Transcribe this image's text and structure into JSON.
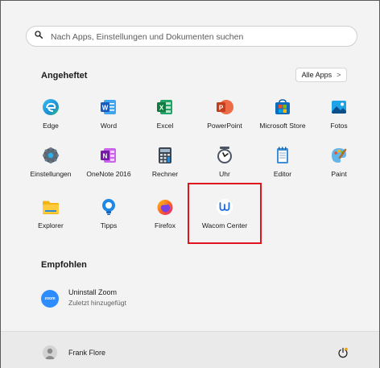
{
  "search": {
    "placeholder": "Nach Apps, Einstellungen und Dokumenten suchen"
  },
  "pinned": {
    "title": "Angeheftet",
    "all_apps_label": "Alle Apps",
    "all_apps_chevron": ">",
    "apps": [
      {
        "label": "Edge",
        "icon": "edge-icon"
      },
      {
        "label": "Word",
        "icon": "word-icon"
      },
      {
        "label": "Excel",
        "icon": "excel-icon"
      },
      {
        "label": "PowerPoint",
        "icon": "powerpoint-icon"
      },
      {
        "label": "Microsoft Store",
        "icon": "store-icon"
      },
      {
        "label": "Fotos",
        "icon": "photos-icon"
      },
      {
        "label": "Einstellungen",
        "icon": "settings-icon"
      },
      {
        "label": "OneNote 2016",
        "icon": "onenote-icon"
      },
      {
        "label": "Rechner",
        "icon": "calculator-icon"
      },
      {
        "label": "Uhr",
        "icon": "clock-icon"
      },
      {
        "label": "Editor",
        "icon": "notepad-icon"
      },
      {
        "label": "Paint",
        "icon": "paint-icon"
      },
      {
        "label": "Explorer",
        "icon": "folder-icon"
      },
      {
        "label": "Tipps",
        "icon": "tips-icon"
      },
      {
        "label": "Firefox",
        "icon": "firefox-icon"
      },
      {
        "label": "Wacom Center",
        "icon": "wacom-icon"
      }
    ]
  },
  "recommended": {
    "title": "Empfohlen",
    "items": [
      {
        "title": "Uninstall Zoom",
        "subtitle": "Zuletzt hinzugefügt",
        "icon_text": "zoom"
      }
    ]
  },
  "footer": {
    "user_name": "Frank Flore"
  },
  "colors": {
    "highlight": "#e0141e",
    "accent": "#0067c0"
  }
}
